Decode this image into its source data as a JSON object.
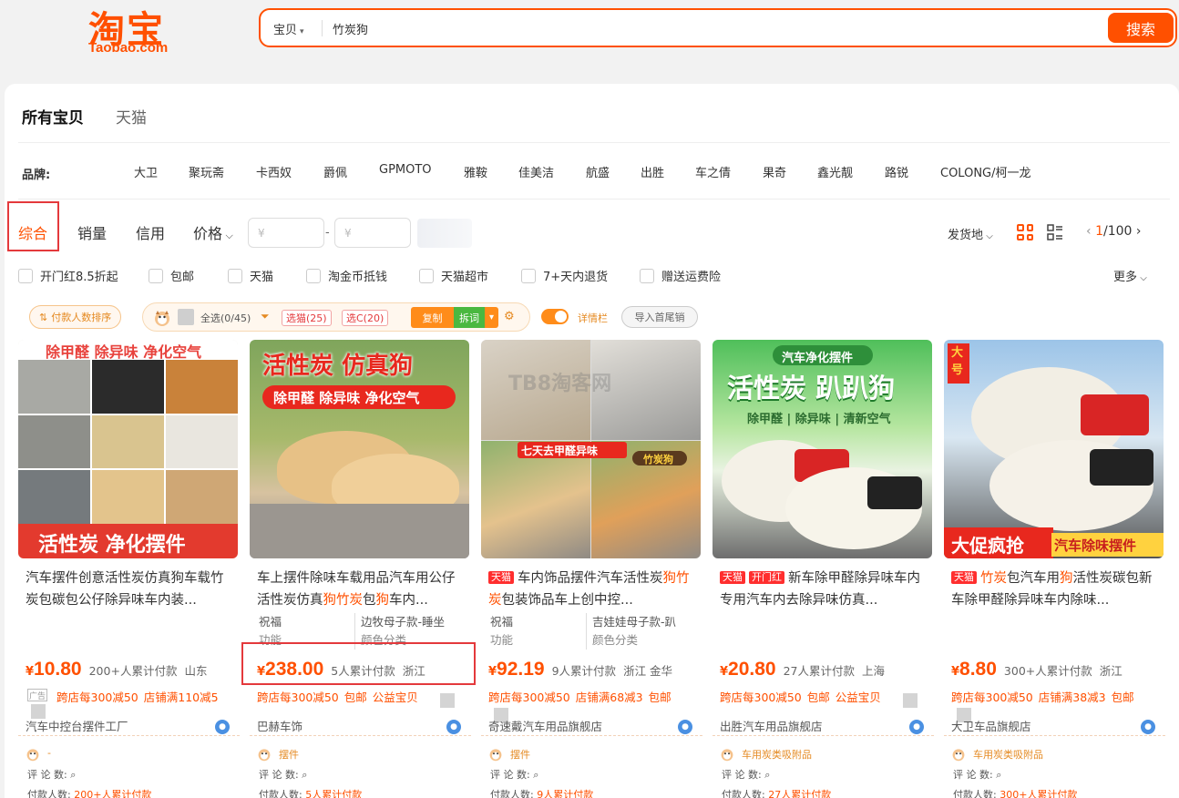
{
  "header": {
    "logo_cn": "淘宝",
    "logo_en": "Taobao.com",
    "search_category": "宝贝",
    "search_query": "竹炭狗",
    "search_button": "搜索"
  },
  "tabs": {
    "active": "所有宝贝",
    "other": "天猫"
  },
  "brands": {
    "label": "品牌:",
    "items": [
      "大卫",
      "聚玩斋",
      "卡西奴",
      "爵佩",
      "GPMOTO",
      "雅鞍",
      "佳美洁",
      "航盛",
      "出胜",
      "车之倩",
      "果奇",
      "鑫光靓",
      "路锐",
      "COLONG/柯一龙"
    ]
  },
  "sort": {
    "comprehensive": "综合",
    "sales": "销量",
    "credit": "信用",
    "price": "价格",
    "price_min_placeholder": "¥",
    "price_max_placeholder": "¥",
    "dash": "-",
    "ship_from": "发货地",
    "page_current": "1",
    "page_total": "/100"
  },
  "filters": [
    "开门红8.5折起",
    "包邮",
    "天猫",
    "淘金币抵钱",
    "天猫超市",
    "7+天内退货",
    "赠送运费险"
  ],
  "more": "更多",
  "plugin": {
    "sort_pill": "付款人数排序",
    "select_all": "全选(0/45)",
    "select_cat": "选猫(25)",
    "select_c": "选C(20)",
    "copy": "复制",
    "split": "拆词",
    "detail_label": "详情栏",
    "import": "导入首尾销"
  },
  "products": [
    {
      "img_top": "除甲醛 除异味 净化空气",
      "img_bottom": "活性炭 净化摆件",
      "badges": [],
      "title": "汽车摆件创意活性炭仿真狗车载竹炭包碳包公仔除异味车内装...",
      "price_yen": "¥",
      "price": "10.80",
      "sold": "200+人累计付款",
      "location": "山东",
      "promos": [
        "跨店每300减50",
        "店铺满110减5"
      ],
      "shop": "汽车中控台摆件工厂",
      "ext_tag": "-",
      "ext_review": "评 论 数:",
      "ext_pay_label": "付款人数:",
      "ext_pay": "200+人累计付款",
      "colors": {
        "bg": "#d9d2c9"
      }
    },
    {
      "img_top": "活性炭 仿真狗",
      "img_sub": "除甲醛 除异味 净化空气",
      "badges": [],
      "title": "车上摆件除味车载用品汽车用公仔活性炭仿真狗竹炭包狗车内...",
      "props": [
        [
          "祝福",
          "边牧母子款-睡坐"
        ],
        [
          "功能",
          "颜色分类"
        ]
      ],
      "price_yen": "¥",
      "price": "238.00",
      "sold": "5人累计付款",
      "location": "浙江",
      "promos": [
        "跨店每300减50",
        "包邮",
        "公益宝贝"
      ],
      "shop": "巴赫车饰",
      "ext_tag": "摆件",
      "ext_review": "评 论 数:",
      "ext_pay_label": "付款人数:",
      "ext_pay": "5人累计付款"
    },
    {
      "img_badge": "七天去甲醛异味",
      "img_tag": "竹炭狗",
      "badges": [
        "天猫"
      ],
      "title": "车内饰品摆件汽车活性炭狗竹炭包装饰品车上创中控...",
      "props": [
        [
          "祝福",
          "吉娃娃母子款-趴"
        ],
        [
          "功能",
          "颜色分类"
        ]
      ],
      "price_yen": "¥",
      "price": "92.19",
      "sold": "9人累计付款",
      "location": "浙江 金华",
      "promos": [
        "跨店每300减50",
        "店铺满68减3",
        "包邮"
      ],
      "shop": "奇速戴汽车用品旗舰店",
      "ext_tag": "摆件",
      "ext_review": "评 论 数:",
      "ext_pay_label": "付款人数:",
      "ext_pay": "9人累计付款"
    },
    {
      "img_top": "汽车净化摆件",
      "img_mid": "活性炭 趴趴狗",
      "img_sub": "除甲醛 | 除异味 | 清新空气",
      "badges": [
        "天猫",
        "开门红"
      ],
      "title": "新车除甲醛除异味车内专用汽车内去除异味仿真...",
      "price_yen": "¥",
      "price": "20.80",
      "sold": "27人累计付款",
      "location": "上海",
      "promos": [
        "跨店每300减50",
        "包邮",
        "公益宝贝"
      ],
      "shop": "出胜汽车用品旗舰店",
      "ext_tag": "车用炭类吸附品",
      "ext_review": "评 论 数:",
      "ext_pay_label": "付款人数:",
      "ext_pay": "27人累计付款"
    },
    {
      "img_corner": "大号",
      "img_bottom_left": "大促疯抢",
      "img_bottom_right": "汽车除味摆件",
      "badges": [
        "天猫"
      ],
      "title": "竹炭包汽车用狗活性炭碳包新车除甲醛除异味车内除味...",
      "price_yen": "¥",
      "price": "8.80",
      "sold": "300+人累计付款",
      "location": "浙江",
      "promos": [
        "跨店每300减50",
        "店铺满38减3",
        "包邮"
      ],
      "shop": "大卫车品旗舰店",
      "ext_tag": "车用炭类吸附品",
      "ext_review": "评 论 数:",
      "ext_pay_label": "付款人数:",
      "ext_pay": "300+人累计付款"
    }
  ],
  "ad_label": "广告",
  "watermark": "TB8淘客网",
  "colors": {
    "brand": "#ff5000",
    "highlight_box": "#e4393c",
    "tmall": "#ff2e2e"
  }
}
